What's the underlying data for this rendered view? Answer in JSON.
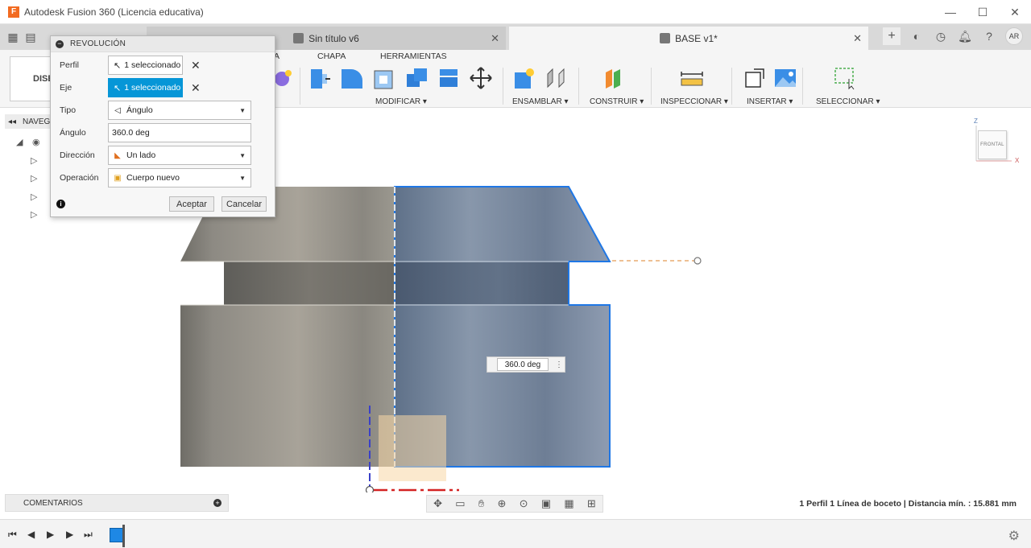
{
  "window": {
    "title": "Autodesk Fusion 360 (Licencia educativa)",
    "logo_letter": "F",
    "minimize": "—",
    "maximize": "☐",
    "close": "✕"
  },
  "tabs": [
    {
      "label": "Sin título v6",
      "active": false
    },
    {
      "label": "BASE v1*",
      "active": true
    }
  ],
  "user": {
    "initials": "AR"
  },
  "ribbon": {
    "workspace_label": "DISE",
    "tabs": [
      "A",
      "CHAPA",
      "HERRAMIENTAS"
    ],
    "groups": [
      "MODIFICAR ▾",
      "ENSAMBLAR ▾",
      "CONSTRUIR ▾",
      "INSPECCIONAR ▾",
      "INSERTAR ▾",
      "SELECCIONAR ▾"
    ]
  },
  "browser": {
    "header": "NAVEG"
  },
  "dialog": {
    "title": "REVOLUCIÓN",
    "rows": {
      "profile": {
        "label": "Perfil",
        "value": "1 seleccionado"
      },
      "axis": {
        "label": "Eje",
        "value": "1 seleccionado"
      },
      "type": {
        "label": "Tipo",
        "value": "Ángulo"
      },
      "angle": {
        "label": "Ángulo",
        "value": "360.0 deg"
      },
      "direction": {
        "label": "Dirección",
        "value": "Un lado"
      },
      "operation": {
        "label": "Operación",
        "value": "Cuerpo nuevo"
      }
    },
    "ok": "Aceptar",
    "cancel": "Cancelar"
  },
  "viewcube": {
    "face": "FRONTAL",
    "z": "Z",
    "x": "X"
  },
  "dimension": {
    "value": "360.0 deg"
  },
  "comments": {
    "label": "COMENTARIOS"
  },
  "status": "1 Perfil 1 Línea de boceto | Distancia mín. : 15.881 mm",
  "colors": {
    "accent": "#0696d7",
    "profile_blue": "#1f77e5",
    "body_gray": "#8d8a83"
  }
}
